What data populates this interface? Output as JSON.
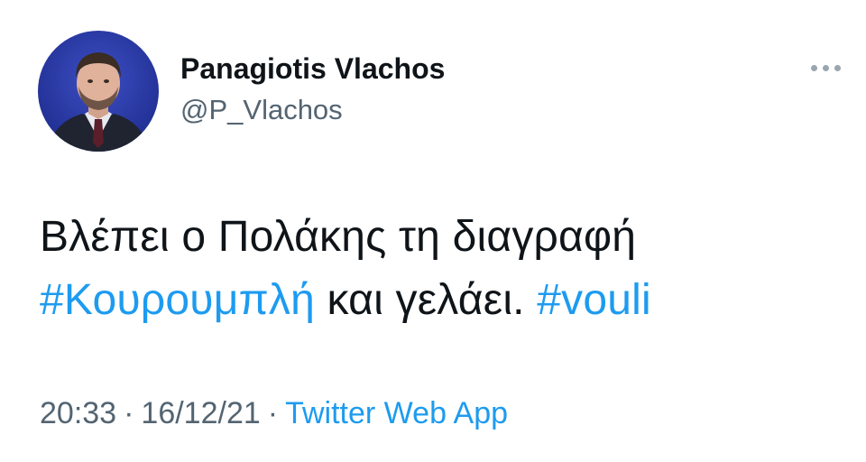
{
  "tweet": {
    "author": {
      "display_name": "Panagiotis Vlachos",
      "handle": "@P_Vlachos"
    },
    "more_icon": "more-horizontal-icon",
    "text": {
      "line1": "Βλέπει ο Πολάκης τη διαγραφή",
      "hashtag1": "#Κουρουμπλή",
      "middle": " και γελάει. ",
      "hashtag2": "#vouli"
    },
    "meta": {
      "time": "20:33",
      "separator": "·",
      "date": "16/12/21",
      "source": "Twitter Web App"
    },
    "colors": {
      "link": "#1d9bf0",
      "secondary": "#536471",
      "text": "#0f1419"
    }
  }
}
